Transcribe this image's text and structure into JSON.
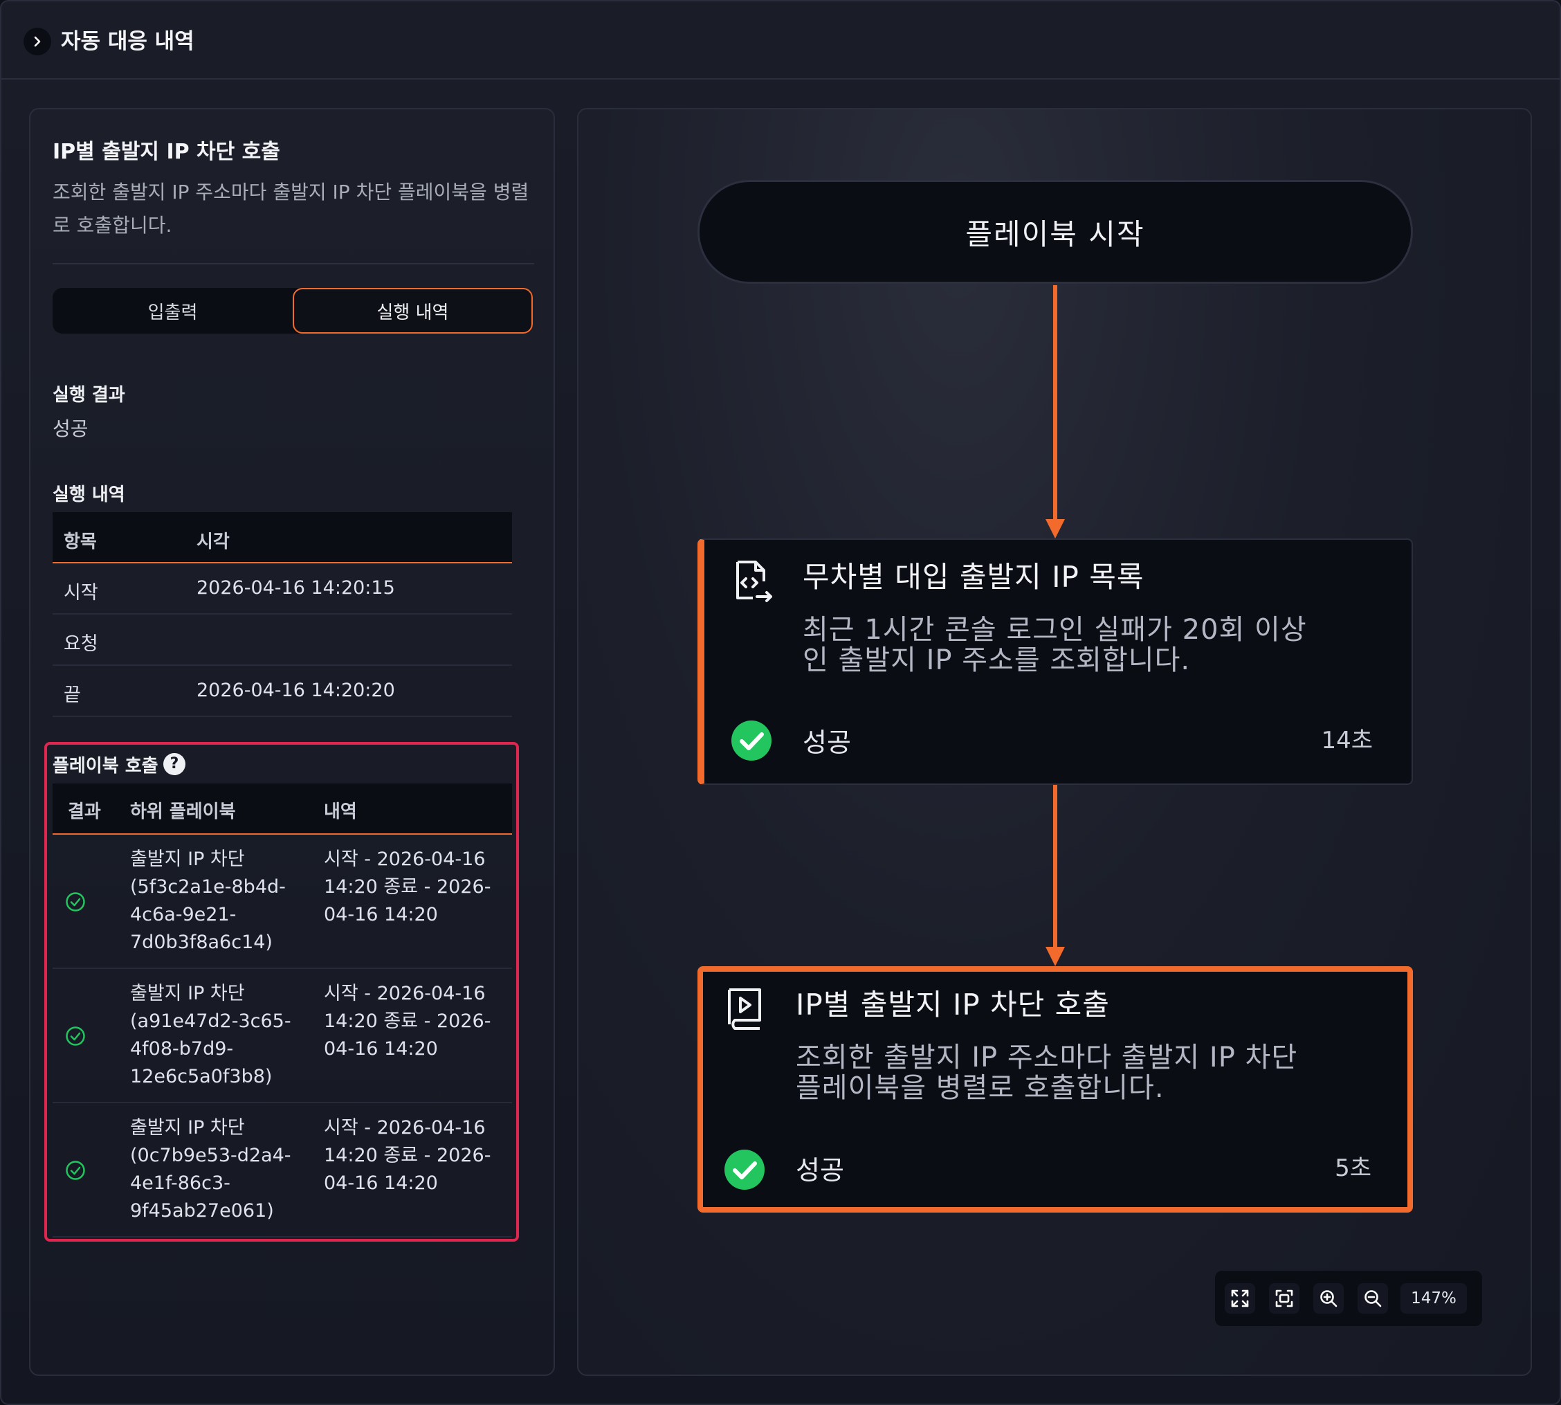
{
  "header": {
    "title": "자동 대응 내역"
  },
  "detail": {
    "title": "IP별 출발지 IP 차단 호출",
    "description": "조회한 출발지 IP 주소마다 출발지 IP 차단 플레이북을 병렬로 호출합니다.",
    "tabs": [
      {
        "label": "입출력",
        "active": false
      },
      {
        "label": "실행 내역",
        "active": true
      }
    ],
    "result_label": "실행 결과",
    "result_value": "성공",
    "history_label": "실행 내역",
    "history_table": {
      "columns": [
        "항목",
        "시각"
      ],
      "rows": [
        {
          "item": "시작",
          "time": "2026-04-16 14:20:15"
        },
        {
          "item": "요청",
          "time": ""
        },
        {
          "item": "끝",
          "time": "2026-04-16 14:20:20"
        }
      ]
    },
    "playbook_calls": {
      "label": "플레이북 호출",
      "help": "?",
      "columns": [
        "결과",
        "하위 플레이북",
        "내역"
      ],
      "rows": [
        {
          "result": "success",
          "sub_playbook": "출발지 IP 차단 (5f3c2a1e-8b4d-4c6a-9e21-7d0b3f8a6c14)",
          "detail": "시작 - 2026-04-16 14:20 종료 - 2026-04-16 14:20"
        },
        {
          "result": "success",
          "sub_playbook": "출발지 IP 차단 (a91e47d2-3c65-4f08-b7d9-12e6c5a0f3b8)",
          "detail": "시작 - 2026-04-16 14:20 종료 - 2026-04-16 14:20"
        },
        {
          "result": "success",
          "sub_playbook": "출발지 IP 차단 (0c7b9e53-d2a4-4e1f-86c3-9f45ab27e061)",
          "detail": "시작 - 2026-04-16 14:20 종료 - 2026-04-16 14:20"
        }
      ]
    }
  },
  "flow": {
    "start_label": "플레이북 시작",
    "nodes": [
      {
        "icon": "code-file-icon",
        "title": "무차별 대입 출발지 IP 목록",
        "description": "최근 1시간 콘솔 로그인 실패가 20회 이상인 출발지 IP 주소를 조회합니다.",
        "status": "성공",
        "duration": "14초",
        "selected": false
      },
      {
        "icon": "playbook-icon",
        "title": "IP별 출발지 IP 차단 호출",
        "description": "조회한 출발지 IP 주소마다 출발지 IP 차단 플레이북을 병렬로 호출합니다.",
        "status": "성공",
        "duration": "5초",
        "selected": true
      }
    ],
    "zoom": "147%"
  },
  "colors": {
    "accent": "#f26b2c",
    "highlight": "#e0264f",
    "success": "#22c55e"
  }
}
